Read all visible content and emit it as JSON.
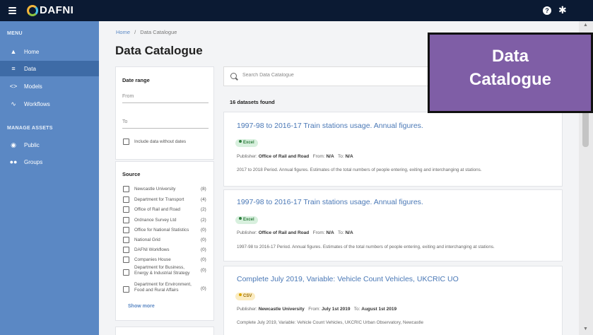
{
  "topbar": {
    "logo_text": "DAFNI",
    "help_symbol": "?",
    "settings_symbol": "✱"
  },
  "sidebar": {
    "menu_header": "MENU",
    "items": [
      {
        "label": "Home",
        "icon": "home-icon"
      },
      {
        "label": "Data",
        "icon": "list-icon"
      },
      {
        "label": "Models",
        "icon": "code-icon"
      },
      {
        "label": "Workflows",
        "icon": "workflow-icon"
      }
    ],
    "manage_header": "MANAGE ASSETS",
    "manage_items": [
      {
        "label": "Public",
        "icon": "eye-icon"
      },
      {
        "label": "Groups",
        "icon": "groups-icon"
      }
    ]
  },
  "breadcrumb": {
    "home": "Home",
    "separator": "/",
    "current": "Data Catalogue"
  },
  "page_title": "Data Catalogue",
  "filters": {
    "date_range_label": "Date range",
    "from_label": "From",
    "to_label": "To",
    "include_without_dates": "Include data without dates",
    "source_label": "Source",
    "sources": [
      {
        "name": "Newcastle University",
        "count": "(8)"
      },
      {
        "name": "Department for Transport",
        "count": "(4)"
      },
      {
        "name": "Office of Rail and Road",
        "count": "(2)"
      },
      {
        "name": "Ordnance Survey Ltd",
        "count": "(2)"
      },
      {
        "name": "Office for National Statistics",
        "count": "(0)"
      },
      {
        "name": "National Grid",
        "count": "(0)"
      },
      {
        "name": "DAFNI Workflows",
        "count": "(0)"
      },
      {
        "name": "Companies House",
        "count": "(0)"
      },
      {
        "name": "Department for Business, Energy & Industrial Strategy",
        "count": "(0)"
      },
      {
        "name": "Department for Environment, Food and Rural Affairs",
        "count": "(0)"
      }
    ],
    "show_more": "Show more"
  },
  "search": {
    "placeholder": "Search Data Catalogue"
  },
  "results_count": "16 datasets found",
  "results": [
    {
      "title": "1997-98 to 2016-17 Train stations usage. Annual figures.",
      "format": "Excel",
      "publisher_label": "Publisher:",
      "publisher": "Office of Rail and Road",
      "from_label": "From:",
      "from": "N/A",
      "to_label": "To:",
      "to": "N/A",
      "description": "2017 to 2018 Period. Annual figures. Estimates of the total numbers of people entering, exiting and interchanging at stations."
    },
    {
      "title": "1997-98 to 2016-17 Train stations usage. Annual figures.",
      "format": "Excel",
      "publisher_label": "Publisher:",
      "publisher": "Office of Rail and Road",
      "from_label": "From:",
      "from": "N/A",
      "to_label": "To:",
      "to": "N/A",
      "description": "1997-98 to 2016-17 Period. Annual figures. Estimates of the total numbers of people entering, exiting and interchanging at stations."
    },
    {
      "title": "Complete July 2019, Variable: Vehicle Count Vehicles, UKCRIC UO",
      "format": "CSV",
      "publisher_label": "Publisher:",
      "publisher": "Newcastle University",
      "from_label": "From:",
      "from": "July 1st 2019",
      "to_label": "To:",
      "to": "August 1st 2019",
      "description": "Complete July 2019, Variable: Vehicle Count Vehicles, UKCRIC Urban Observatory, Newcastle"
    }
  ],
  "overlay": {
    "line1": "Data",
    "line2": "Catalogue",
    "color": "#7f5ea6"
  },
  "colors": {
    "topbar": "#0b1a33",
    "sidebar": "#5b88c4",
    "link": "#4a78b6"
  }
}
